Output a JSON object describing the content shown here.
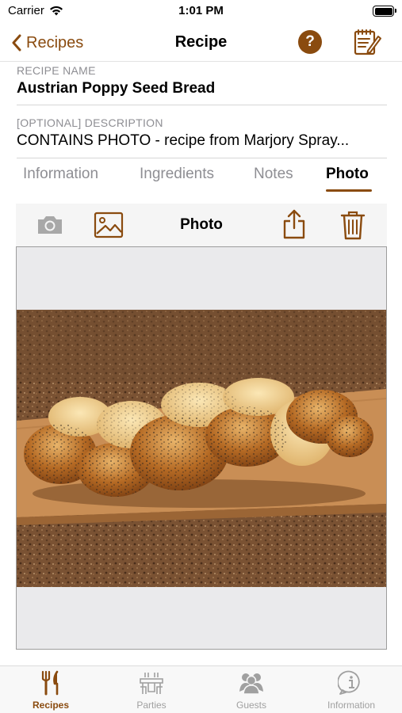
{
  "status": {
    "carrier": "Carrier",
    "time": "1:01 PM"
  },
  "nav": {
    "back_label": "Recipes",
    "title": "Recipe",
    "help_glyph": "?"
  },
  "recipe_name": {
    "label": "RECIPE NAME",
    "value": "Austrian Poppy Seed Bread"
  },
  "description": {
    "label": "[OPTIONAL] DESCRIPTION",
    "value": "CONTAINS PHOTO - recipe from Marjory Spray..."
  },
  "tabs": [
    {
      "label": "Information",
      "active": false
    },
    {
      "label": "Ingredients",
      "active": false
    },
    {
      "label": "Notes",
      "active": false
    },
    {
      "label": "Photo",
      "active": true
    }
  ],
  "photo_toolbar": {
    "title": "Photo",
    "icons": [
      "camera-icon",
      "photo-library-icon",
      "share-icon",
      "trash-icon"
    ]
  },
  "photo": {
    "subject": "braided poppy seed bread on wooden cutting board"
  },
  "tab_bar": [
    {
      "label": "Recipes",
      "icon": "fork-knife-icon",
      "active": true
    },
    {
      "label": "Parties",
      "icon": "dining-table-icon",
      "active": false
    },
    {
      "label": "Guests",
      "icon": "people-icon",
      "active": false
    },
    {
      "label": "Information",
      "icon": "info-icon",
      "active": false
    }
  ],
  "colors": {
    "accent": "#8a4b0f",
    "inactive": "#8e8e93",
    "toolbar_bg": "#f5f5f5",
    "photo_bg": "#eaeaec"
  }
}
